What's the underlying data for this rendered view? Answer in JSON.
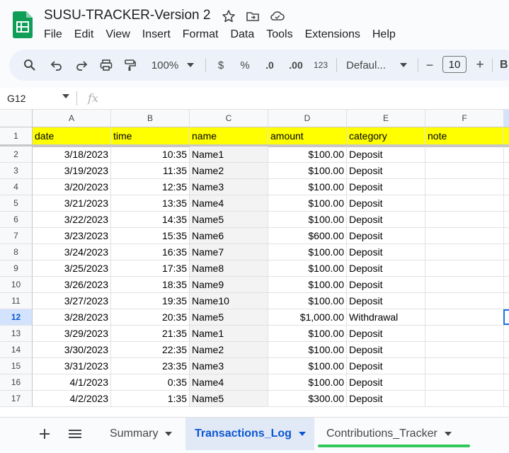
{
  "title_bar": {
    "doc_title": "SUSU-TRACKER-Version 2",
    "menu": [
      "File",
      "Edit",
      "View",
      "Insert",
      "Format",
      "Data",
      "Tools",
      "Extensions",
      "Help"
    ]
  },
  "toolbar": {
    "zoom": "100%",
    "currency": "$",
    "percent": "%",
    "decrease_decimal": ".0",
    "increase_decimal": ".00",
    "number_format": "123",
    "font_family": "Defaul...",
    "font_size": "10",
    "minus": "−",
    "plus": "+",
    "bold": "B"
  },
  "formula_bar": {
    "name_box": "G12",
    "fx_label": "fx"
  },
  "grid": {
    "columns": [
      "A",
      "B",
      "C",
      "D",
      "E",
      "F"
    ],
    "header_row": {
      "number": "1",
      "cells": [
        "date",
        "time",
        "name",
        "amount",
        "category",
        "note"
      ]
    },
    "active_row": "12",
    "rows": [
      {
        "n": "2",
        "date": "3/18/2023",
        "time": "10:35",
        "name": "Name1",
        "amount": "$100.00",
        "category": "Deposit"
      },
      {
        "n": "3",
        "date": "3/19/2023",
        "time": "11:35",
        "name": "Name2",
        "amount": "$100.00",
        "category": "Deposit"
      },
      {
        "n": "4",
        "date": "3/20/2023",
        "time": "12:35",
        "name": "Name3",
        "amount": "$100.00",
        "category": "Deposit"
      },
      {
        "n": "5",
        "date": "3/21/2023",
        "time": "13:35",
        "name": "Name4",
        "amount": "$100.00",
        "category": "Deposit"
      },
      {
        "n": "6",
        "date": "3/22/2023",
        "time": "14:35",
        "name": "Name5",
        "amount": "$100.00",
        "category": "Deposit"
      },
      {
        "n": "7",
        "date": "3/23/2023",
        "time": "15:35",
        "name": "Name6",
        "amount": "$600.00",
        "category": "Deposit"
      },
      {
        "n": "8",
        "date": "3/24/2023",
        "time": "16:35",
        "name": "Name7",
        "amount": "$100.00",
        "category": "Deposit"
      },
      {
        "n": "9",
        "date": "3/25/2023",
        "time": "17:35",
        "name": "Name8",
        "amount": "$100.00",
        "category": "Deposit"
      },
      {
        "n": "10",
        "date": "3/26/2023",
        "time": "18:35",
        "name": "Name9",
        "amount": "$100.00",
        "category": "Deposit"
      },
      {
        "n": "11",
        "date": "3/27/2023",
        "time": "19:35",
        "name": "Name10",
        "amount": "$100.00",
        "category": "Deposit"
      },
      {
        "n": "12",
        "date": "3/28/2023",
        "time": "20:35",
        "name": "Name5",
        "amount": "$1,000.00",
        "category": "Withdrawal"
      },
      {
        "n": "13",
        "date": "3/29/2023",
        "time": "21:35",
        "name": "Name1",
        "amount": "$100.00",
        "category": "Deposit"
      },
      {
        "n": "14",
        "date": "3/30/2023",
        "time": "22:35",
        "name": "Name2",
        "amount": "$100.00",
        "category": "Deposit"
      },
      {
        "n": "15",
        "date": "3/31/2023",
        "time": "23:35",
        "name": "Name3",
        "amount": "$100.00",
        "category": "Deposit"
      },
      {
        "n": "16",
        "date": "4/1/2023",
        "time": "0:35",
        "name": "Name4",
        "amount": "$100.00",
        "category": "Deposit"
      },
      {
        "n": "17",
        "date": "4/2/2023",
        "time": "1:35",
        "name": "Name5",
        "amount": "$300.00",
        "category": "Deposit"
      }
    ]
  },
  "sheet_tabs": {
    "tabs": [
      {
        "label": "Summary",
        "active": false,
        "underline_color": ""
      },
      {
        "label": "Transactions_Log",
        "active": true,
        "underline_color": ""
      },
      {
        "label": "Contributions_Tracker",
        "active": false,
        "underline_color": "#34c759"
      }
    ]
  },
  "colors": {
    "header_fill": "#ffff00",
    "accent": "#0b57d0",
    "sheets_green": "#0f9d58"
  }
}
